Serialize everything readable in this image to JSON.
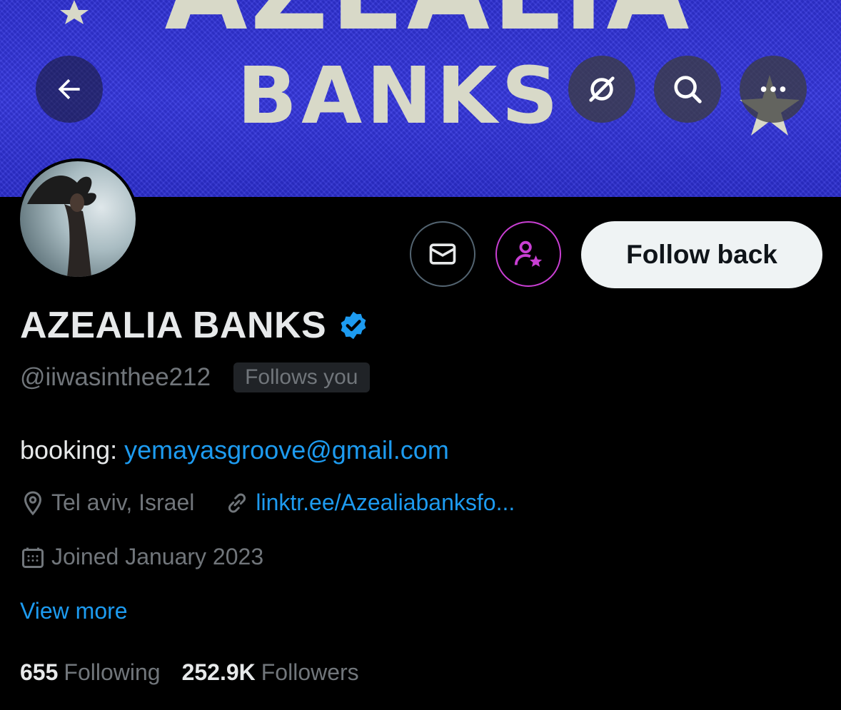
{
  "banner": {
    "text_line1": "AZEALIA",
    "text_line2": "BANKS",
    "background_color": "#3335dc",
    "text_color": "#d8d9c8"
  },
  "topbar": {
    "back_icon": "arrow-left-icon",
    "grok_icon": "grok-icon",
    "search_icon": "search-icon",
    "more_icon": "more-horizontal-icon"
  },
  "profile": {
    "name": "AZEALIA BANKS",
    "verified": true,
    "handle": "@iiwasinthee212",
    "follows_you_label": "Follows you",
    "bio_prefix": "booking: ",
    "bio_email": "yemayasgroove@gmail.com",
    "location": "Tel aviv, Israel",
    "website": "linktr.ee/Azealiabanksfo...",
    "joined": "Joined January 2023",
    "view_more_label": "View more"
  },
  "actions": {
    "message_icon": "mail-icon",
    "notify_icon": "person-star-icon",
    "follow_label": "Follow back"
  },
  "stats": {
    "following_count": "655",
    "following_label": "Following",
    "followers_count": "252.9K",
    "followers_label": "Followers"
  },
  "colors": {
    "accent_blue": "#1d9bf0",
    "notify_purple": "#c93fd3",
    "secondary_text": "#71767b",
    "primary_text": "#e7e9ea"
  }
}
